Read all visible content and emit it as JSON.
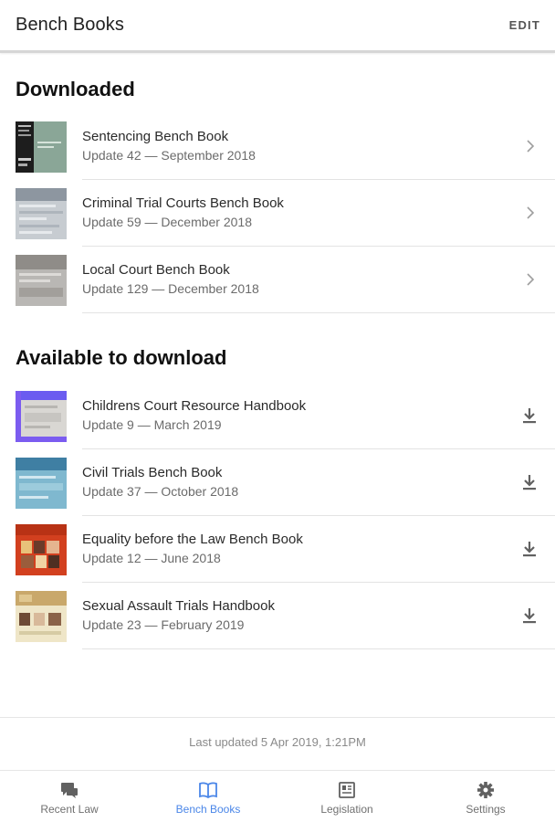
{
  "app_bar": {
    "title": "Bench Books",
    "edit_label": "EDIT"
  },
  "downloaded": {
    "title": "Downloaded",
    "items": [
      {
        "title": "Sentencing Bench Book",
        "subtitle": "Update 42 — September 2018"
      },
      {
        "title": "Criminal Trial Courts Bench Book",
        "subtitle": "Update 59 — December 2018"
      },
      {
        "title": "Local Court Bench Book",
        "subtitle": "Update 129 — December 2018"
      }
    ]
  },
  "available": {
    "title": "Available to download",
    "items": [
      {
        "title": "Childrens Court Resource Handbook",
        "subtitle": "Update 9 — March 2019"
      },
      {
        "title": "Civil Trials Bench Book",
        "subtitle": "Update 37 — October 2018"
      },
      {
        "title": "Equality before the Law Bench Book",
        "subtitle": "Update 12 — June 2018"
      },
      {
        "title": "Sexual Assault Trials Handbook",
        "subtitle": "Update 23 — February 2019"
      }
    ]
  },
  "footer": {
    "last_updated": "Last updated 5 Apr 2019, 1:21PM"
  },
  "bottom_nav": {
    "items": [
      {
        "label": "Recent Law",
        "icon": "chat-bubbles-icon"
      },
      {
        "label": "Bench Books",
        "icon": "open-book-icon"
      },
      {
        "label": "Legislation",
        "icon": "document-icon"
      },
      {
        "label": "Settings",
        "icon": "gear-icon"
      }
    ],
    "active": "Bench Books"
  },
  "colors": {
    "accent": "#4a86e8",
    "text": "#212121",
    "muted": "#6b6b6b"
  }
}
